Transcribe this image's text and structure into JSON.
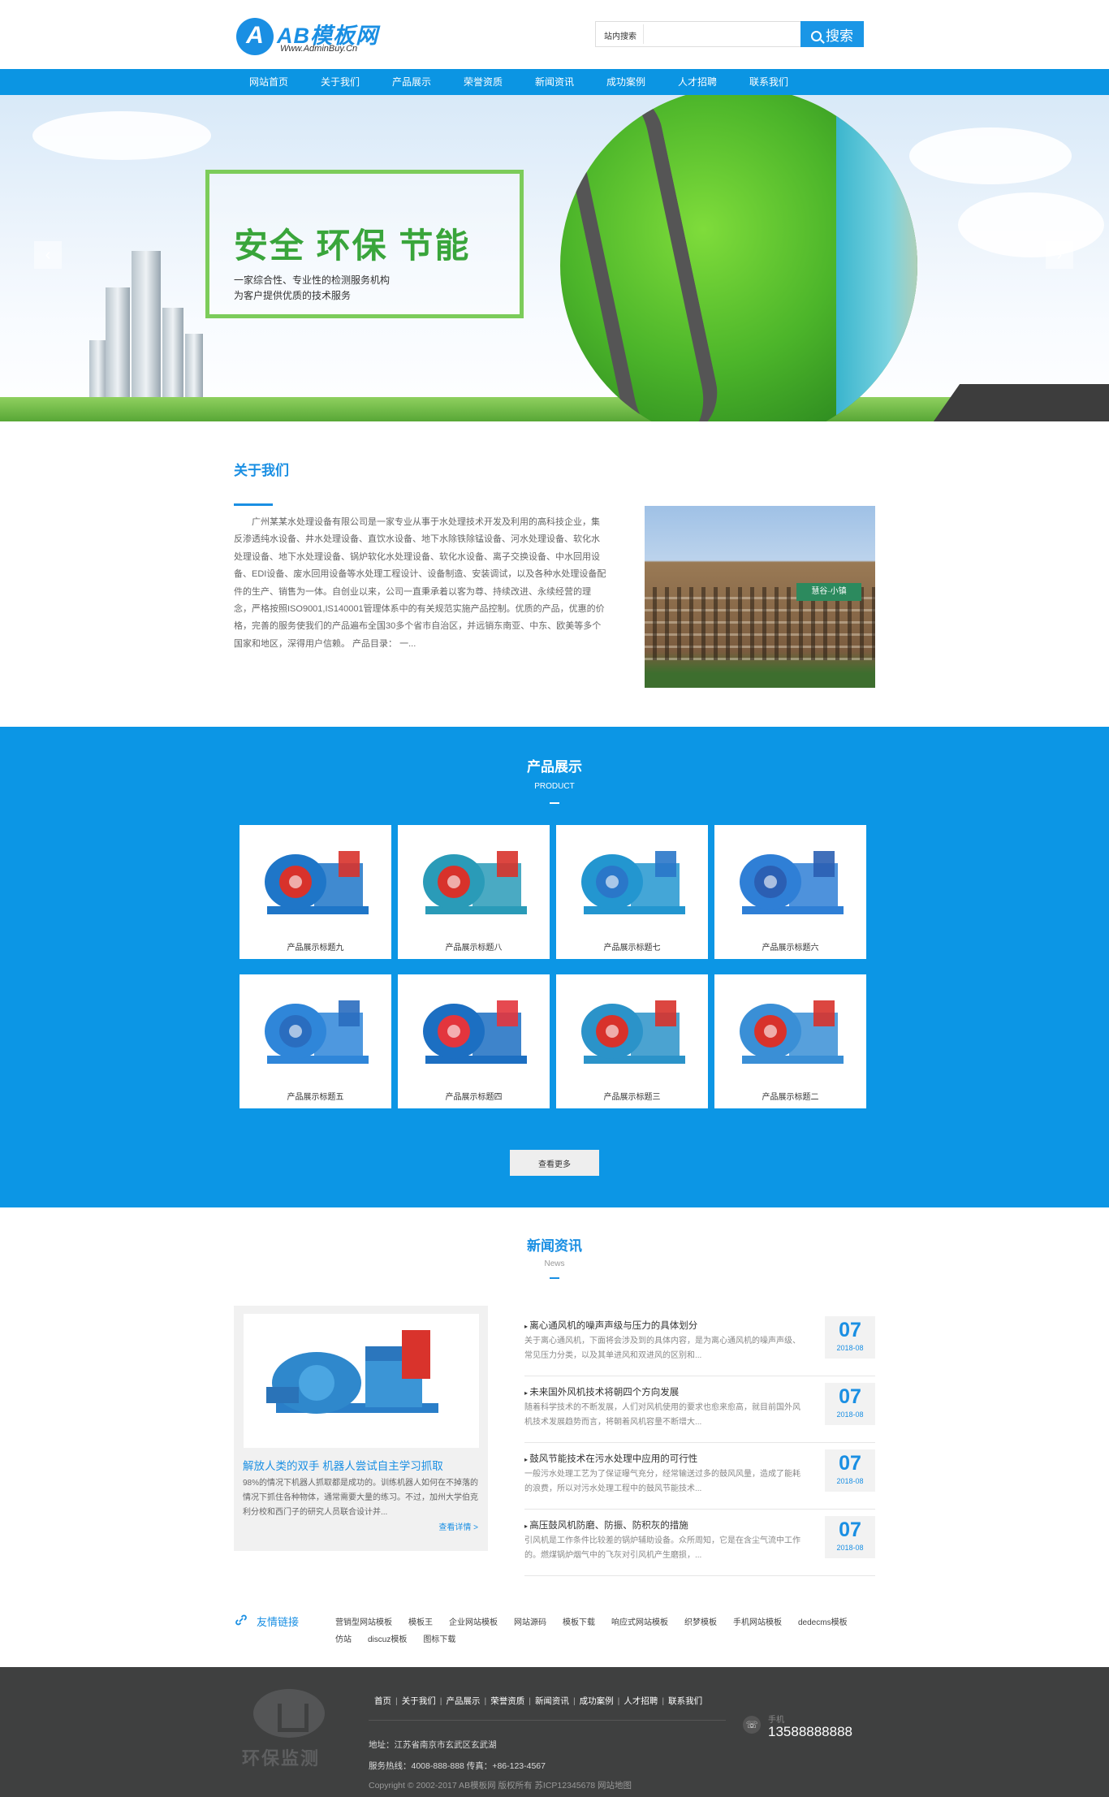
{
  "header": {
    "logo_text": "AB模板网",
    "logo_sub": "Www.AdminBuy.Cn",
    "logo_mark": "A",
    "search_label": "站内搜索",
    "search_placeholder": "",
    "search_button": "搜索"
  },
  "nav": [
    "网站首页",
    "关于我们",
    "产品展示",
    "荣誉资质",
    "新闻资讯",
    "成功案例",
    "人才招聘",
    "联系我们"
  ],
  "banner": {
    "title": "安全 环保 节能",
    "line1": "一家综合性、专业性的检测服务机构",
    "line2": "为客户提供优质的技术服务",
    "prev": "‹",
    "next": "›"
  },
  "about": {
    "title": "关于我们",
    "text": "广州某某水处理设备有限公司是一家专业从事于水处理技术开发及利用的高科技企业，集反渗透纯水设备、井水处理设备、直饮水设备、地下水除铁除锰设备、河水处理设备、软化水处理设备、地下水处理设备、锅炉软化水处理设备、软化水设备、离子交换设备、中水回用设备、EDI设备、废水回用设备等水处理工程设计、设备制造、安装调试，以及各种水处理设备配件的生产、销售为一体。自创业以来，公司一直秉承着以客为尊、持续改进、永续经营的理念，严格按照ISO9001,IS140001管理体系中的有关规范实施产品控制。优质的产品，优惠的价格，完善的服务使我们的产品遍布全国30多个省市自治区，并远销东南亚、中东、欧美等多个国家和地区，深得用户信赖。 产品目录： 一...",
    "photo_sign": "慧谷·小镇"
  },
  "products": {
    "title": "产品展示",
    "subtitle": "PRODUCT",
    "items": [
      {
        "label": "产品展示标题九",
        "color": "#1f76c8",
        "accent": "#d8322b"
      },
      {
        "label": "产品展示标题八",
        "color": "#2a9bb8",
        "accent": "#d8322b"
      },
      {
        "label": "产品展示标题七",
        "color": "#2396d0",
        "accent": "#2a77c9"
      },
      {
        "label": "产品展示标题六",
        "color": "#2f7fd6",
        "accent": "#2b5fb3"
      },
      {
        "label": "产品展示标题五",
        "color": "#2f86d9",
        "accent": "#2a6dbf"
      },
      {
        "label": "产品展示标题四",
        "color": "#1c6fc2",
        "accent": "#e3353d"
      },
      {
        "label": "产品展示标题三",
        "color": "#2b93c9",
        "accent": "#d8322b"
      },
      {
        "label": "产品展示标题二",
        "color": "#3a8fd6",
        "accent": "#d8322b"
      }
    ],
    "more_button": "查看更多"
  },
  "news": {
    "title": "新闻资讯",
    "subtitle": "News",
    "feature": {
      "title": "解放人类的双手 机器人尝试自主学习抓取",
      "text": "98%的情况下机器人抓取都是成功的。训练机器人如何在不掉落的情况下抓住各种物体，通常需要大量的练习。不过，加州大学伯克利分校和西门子的研究人员联合设计并...",
      "more": "查看详情 >"
    },
    "items": [
      {
        "title": "离心通风机的噪声声级与压力的具体划分",
        "desc": "关于离心通风机，下面将会涉及到的具体内容，是为离心通风机的噪声声级、常见压力分类，以及其单进风和双进风的区别和...",
        "day": "07",
        "ym": "2018-08"
      },
      {
        "title": "未来国外风机技术将朝四个方向发展",
        "desc": "随着科学技术的不断发展，人们对风机使用的要求也愈来愈高，就目前国外风机技术发展趋势而言，将朝着风机容量不断增大...",
        "day": "07",
        "ym": "2018-08"
      },
      {
        "title": "鼓风节能技术在污水处理中应用的可行性",
        "desc": "一般污水处理工艺为了保证曝气充分，经常输送过多的鼓风风量，造成了能耗的浪费，所以对污水处理工程中的鼓风节能技术...",
        "day": "07",
        "ym": "2018-08"
      },
      {
        "title": "高压鼓风机防磨、防振、防积灰的措施",
        "desc": "引风机是工作条件比较差的锅炉辅助设备。众所周知，它是在含尘气流中工作的。燃煤锅炉烟气中的飞灰对引风机产生磨损，...",
        "day": "07",
        "ym": "2018-08"
      }
    ]
  },
  "links": {
    "label": "友情链接",
    "items": [
      "营销型网站模板",
      "模板王",
      "企业网站模板",
      "网站源码",
      "模板下载",
      "响应式网站模板",
      "织梦模板",
      "手机网站模板",
      "dedecms模板",
      "仿站",
      "discuz模板",
      "图标下载"
    ]
  },
  "footer": {
    "logo_text": "环保监测",
    "nav": [
      "首页",
      "关于我们",
      "产品展示",
      "荣誉资质",
      "新闻资讯",
      "成功案例",
      "人才招聘",
      "联系我们"
    ],
    "address": "地址：江苏省南京市玄武区玄武湖",
    "hotline": "服务热线：4008-888-888 传真：+86-123-4567",
    "copyright": "Copyright © 2002-2017 AB模板网 版权所有   苏ICP12345678   网站地图",
    "phone_label": "手机",
    "phone": "13588888888"
  },
  "colors": {
    "brand": "#1a8fe3",
    "nav": "#0b95e3",
    "product_bg": "#0c96e5",
    "footer": "#3f4040"
  }
}
